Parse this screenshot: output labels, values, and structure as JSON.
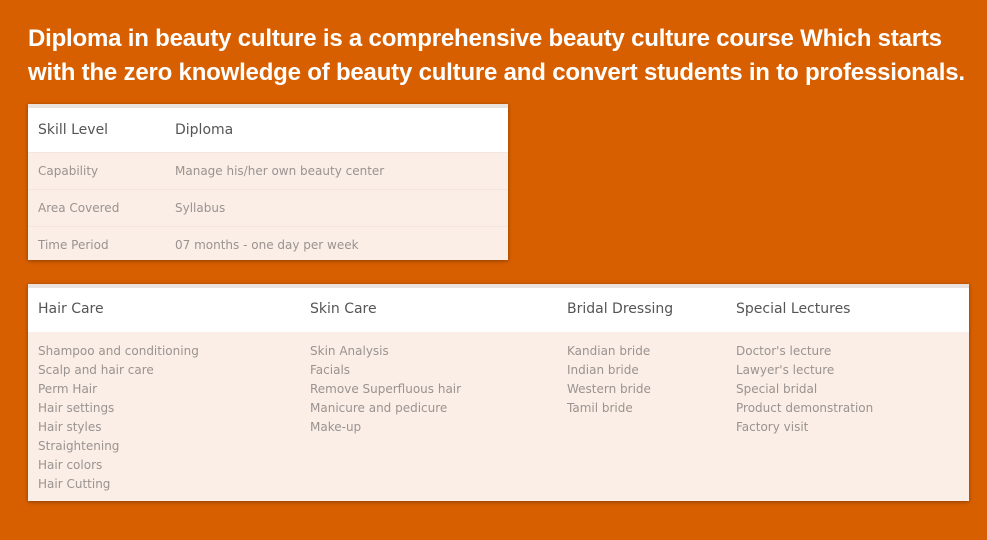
{
  "headline": "Diploma in beauty culture is a comprehensive beauty culture course Which starts with the zero knowledge of beauty culture and convert students in to professionals.",
  "skill_table": {
    "header": {
      "label": "Skill Level",
      "value": "Diploma"
    },
    "rows": [
      {
        "label": "Capability",
        "value": "Manage his/her own beauty center"
      },
      {
        "label": "Area Covered",
        "value": "Syllabus"
      },
      {
        "label": "Time Period",
        "value": "07 months - one day per week"
      }
    ]
  },
  "syllabus": {
    "columns": [
      {
        "title": "Hair Care",
        "items": [
          "Shampoo and conditioning",
          "Scalp and hair care",
          "Perm Hair",
          "Hair settings",
          "Hair styles",
          "Straightening",
          "Hair colors",
          "Hair Cutting"
        ]
      },
      {
        "title": "Skin Care",
        "items": [
          "Skin Analysis",
          "Facials",
          "Remove Superfluous hair",
          "Manicure and pedicure",
          "Make-up"
        ]
      },
      {
        "title": "Bridal Dressing",
        "items": [
          "Kandian bride",
          "Indian bride",
          "Western bride",
          "Tamil bride"
        ]
      },
      {
        "title": "Special Lectures",
        "items": [
          "Doctor's lecture",
          "Lawyer's lecture",
          "Special bridal",
          "Product demonstration",
          "Factory visit"
        ]
      }
    ]
  },
  "colors": {
    "background": "#d75f00",
    "card_body": "#fbeee6",
    "card_header": "#ffffff"
  }
}
